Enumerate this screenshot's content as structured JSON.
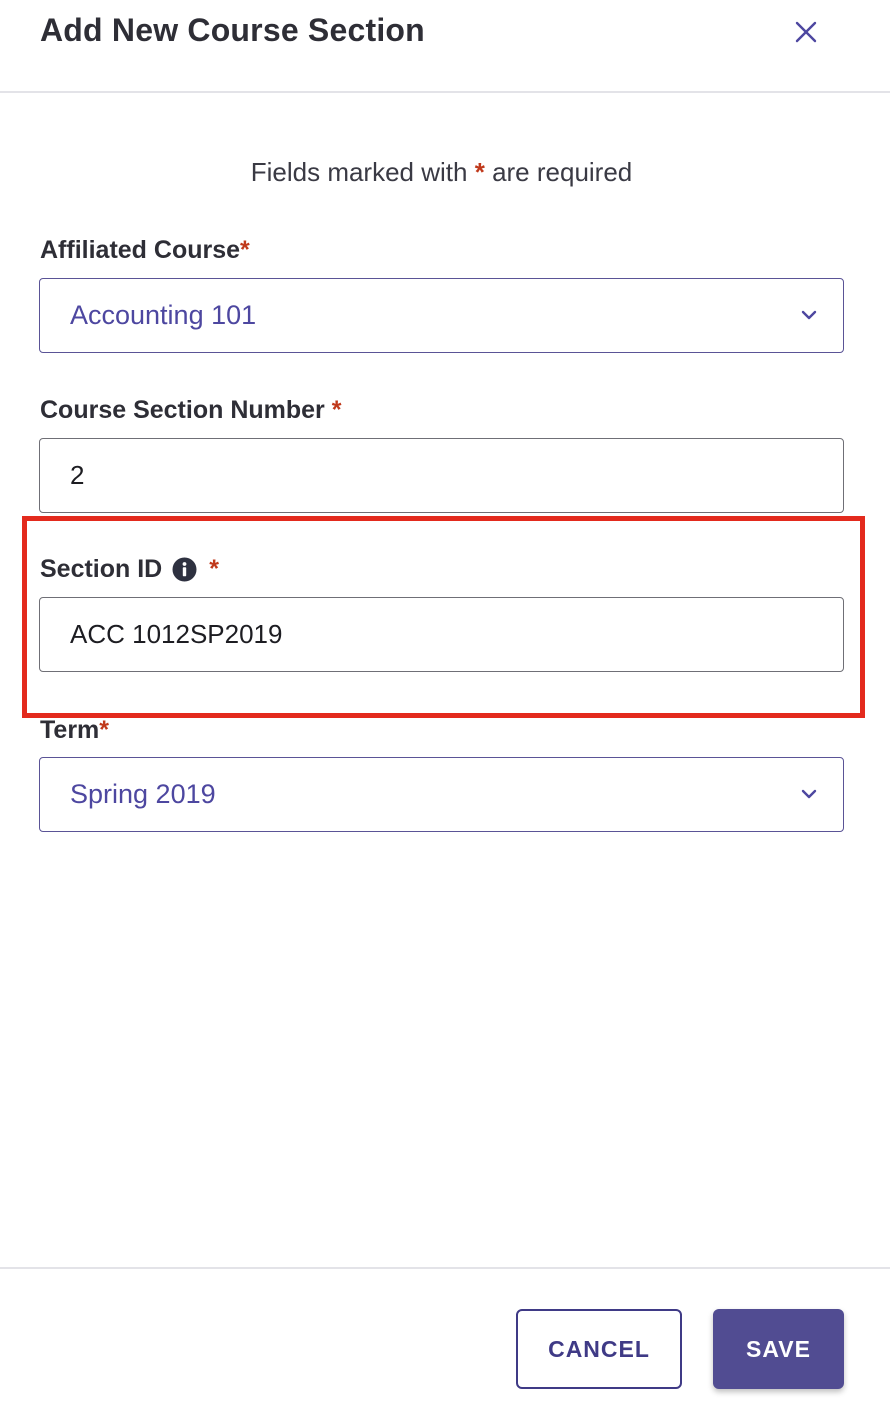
{
  "dialog": {
    "title": "Add New Course Section",
    "close_icon": "close-icon"
  },
  "required_note": {
    "before": "Fields marked with",
    "star": "*",
    "after": "are required"
  },
  "fields": {
    "affiliated_course": {
      "label": "Affiliated Course",
      "required_marker": "*",
      "value": "Accounting 101",
      "icon": "chevron-down-icon"
    },
    "section_number": {
      "label": "Course Section Number",
      "required_marker": "*",
      "value": "2"
    },
    "section_id": {
      "label": "Section ID",
      "info_icon": "info-icon",
      "required_marker": "*",
      "value": "ACC 1012SP2019"
    },
    "term": {
      "label": "Term",
      "required_marker": "*",
      "value": "Spring 2019",
      "icon": "chevron-down-icon"
    }
  },
  "footer": {
    "cancel_label": "CANCEL",
    "save_label": "SAVE"
  },
  "colors": {
    "accent": "#514c92",
    "required": "#c0391b",
    "highlight": "#e32a1d"
  }
}
